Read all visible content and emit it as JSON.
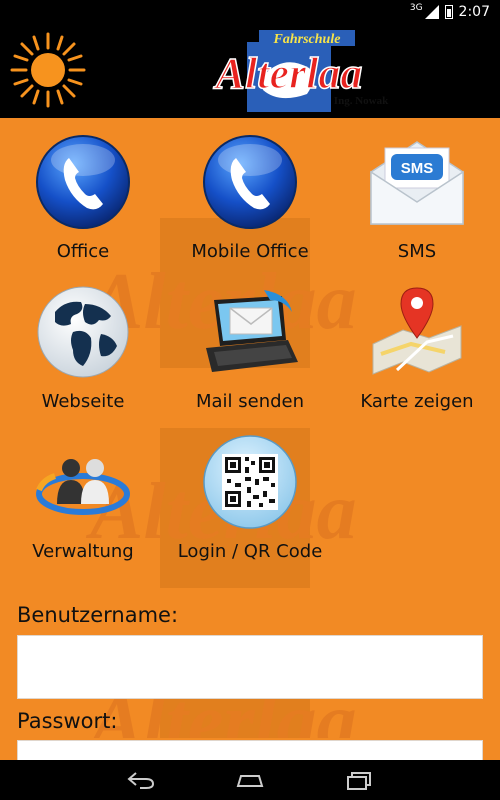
{
  "status_bar": {
    "network": "3G",
    "time": "2:07"
  },
  "header": {
    "logo_top_text": "Fahrschule",
    "logo_main_text": "Alterlaa",
    "logo_sub_text": "Ing. Nowak",
    "sun_icon": "sun-icon"
  },
  "tiles": [
    {
      "label": "Office",
      "icon": "phone-icon"
    },
    {
      "label": "Mobile Office",
      "icon": "phone-icon"
    },
    {
      "label": "SMS",
      "icon": "sms-envelope-icon"
    },
    {
      "label": "Webseite",
      "icon": "globe-icon"
    },
    {
      "label": "Mail senden",
      "icon": "laptop-mail-icon"
    },
    {
      "label": "Karte zeigen",
      "icon": "map-pin-icon"
    },
    {
      "label": "Verwaltung",
      "icon": "users-icon"
    },
    {
      "label": "Login / QR Code",
      "icon": "qr-code-icon"
    }
  ],
  "form": {
    "username_label": "Benutzername:",
    "username_value": "",
    "password_label": "Passwort:",
    "password_value": ""
  },
  "colors": {
    "background": "#f28a24",
    "header": "#000000",
    "logo_red": "#e8231f",
    "logo_blue": "#2a5fb8",
    "phone_blue": "#1a63d6"
  },
  "navbar": {
    "back_icon": "back-icon",
    "home_icon": "home-icon",
    "recents_icon": "recent-apps-icon"
  }
}
